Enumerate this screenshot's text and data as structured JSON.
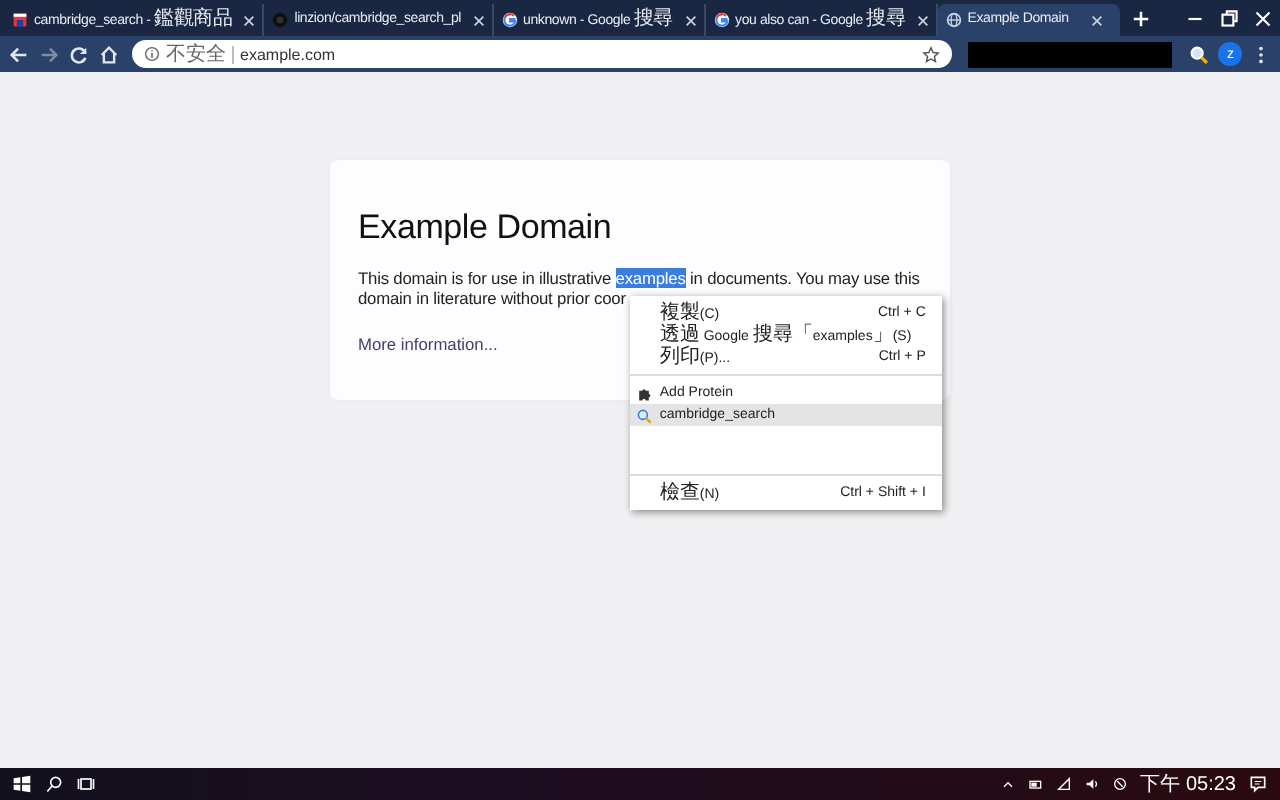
{
  "tabs": [
    {
      "kind": "store",
      "title": "cambridge_search - 鑑觀商品",
      "selected": false
    },
    {
      "kind": "repo",
      "title": "linzion/cambridge_search_pl",
      "selected": false
    },
    {
      "kind": "google",
      "title": "unknown - Google 搜尋",
      "selected": false
    },
    {
      "kind": "google",
      "title": "you also can - Google 搜尋",
      "selected": false
    },
    {
      "kind": "page",
      "title": "Example Domain",
      "selected": true
    }
  ],
  "address_bar": {
    "security": "不安全",
    "url": "example.com"
  },
  "profile": {
    "initial": "z"
  },
  "page": {
    "heading": "Example Domain",
    "text_before": "This domain is for use in illustrative ",
    "selected_text": "examples",
    "text_after": " in documents. You may use this domain in literature without prior coor",
    "link": "More information..."
  },
  "context_menu": [
    {
      "kind": "command",
      "label": "複製(C)",
      "shortcut": "Ctrl + C",
      "selected": false
    },
    {
      "kind": "command",
      "label": "透過 Google 搜尋「examples」(S)",
      "selected": false
    },
    {
      "kind": "command",
      "label": "列印(P)...",
      "shortcut": "Ctrl + P",
      "selected": false
    },
    {
      "kind": "separator"
    },
    {
      "kind": "extension",
      "label": "Add Protein",
      "selected": false
    },
    {
      "kind": "app",
      "label": "cambridge_search",
      "selected": true
    },
    {
      "kind": "spacer"
    },
    {
      "kind": "separator"
    },
    {
      "kind": "command",
      "label": "檢查(N)",
      "shortcut": "Ctrl + Shift + I",
      "selected": false
    }
  ],
  "taskbar": {
    "time": "下午 05:23"
  }
}
